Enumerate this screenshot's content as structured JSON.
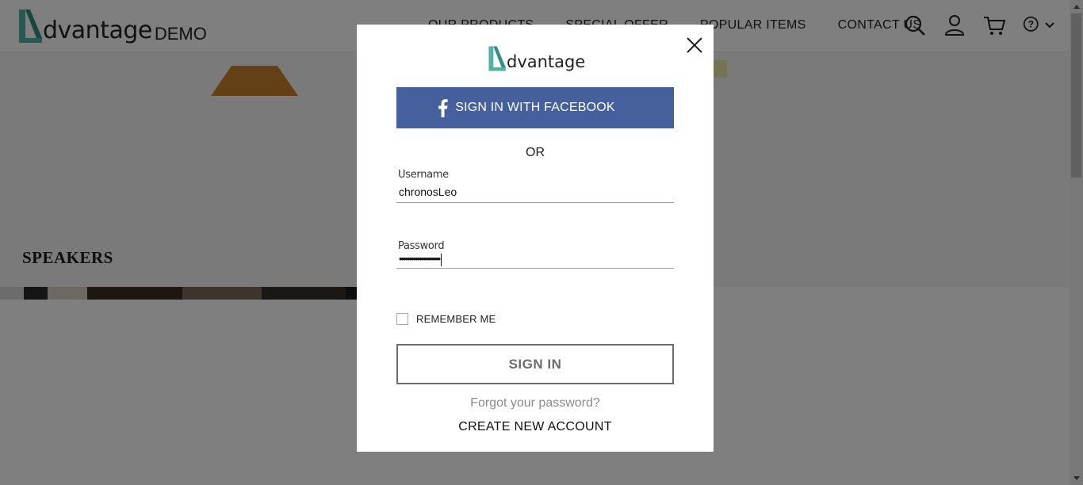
{
  "site": {
    "logo_text": "dvantage",
    "logo_demo": "DEMO",
    "nav": [
      "OUR PRODUCTS",
      "SPECIAL OFFER",
      "POPULAR ITEMS",
      "CONTACT US"
    ],
    "icons": [
      "search-icon",
      "user-icon",
      "cart-icon",
      "help-icon",
      "chevron-down-icon"
    ],
    "brand_color": "#5fb7aa"
  },
  "page": {
    "category_title": "SPEAKERS"
  },
  "modal": {
    "logo_text": "dvantage",
    "facebook_label": "SIGN IN WITH FACEBOOK",
    "facebook_color": "#46609e",
    "or_text": "OR",
    "username_label": "Username",
    "username_value": "chronosLeo",
    "password_label": "Password",
    "password_value": "••••••••••••••••••••",
    "remember_label": "REMEMBER ME",
    "remember_checked": false,
    "signin_label": "SIGN IN",
    "forgot_label": "Forgot your password?",
    "create_label": "CREATE NEW ACCOUNT"
  }
}
